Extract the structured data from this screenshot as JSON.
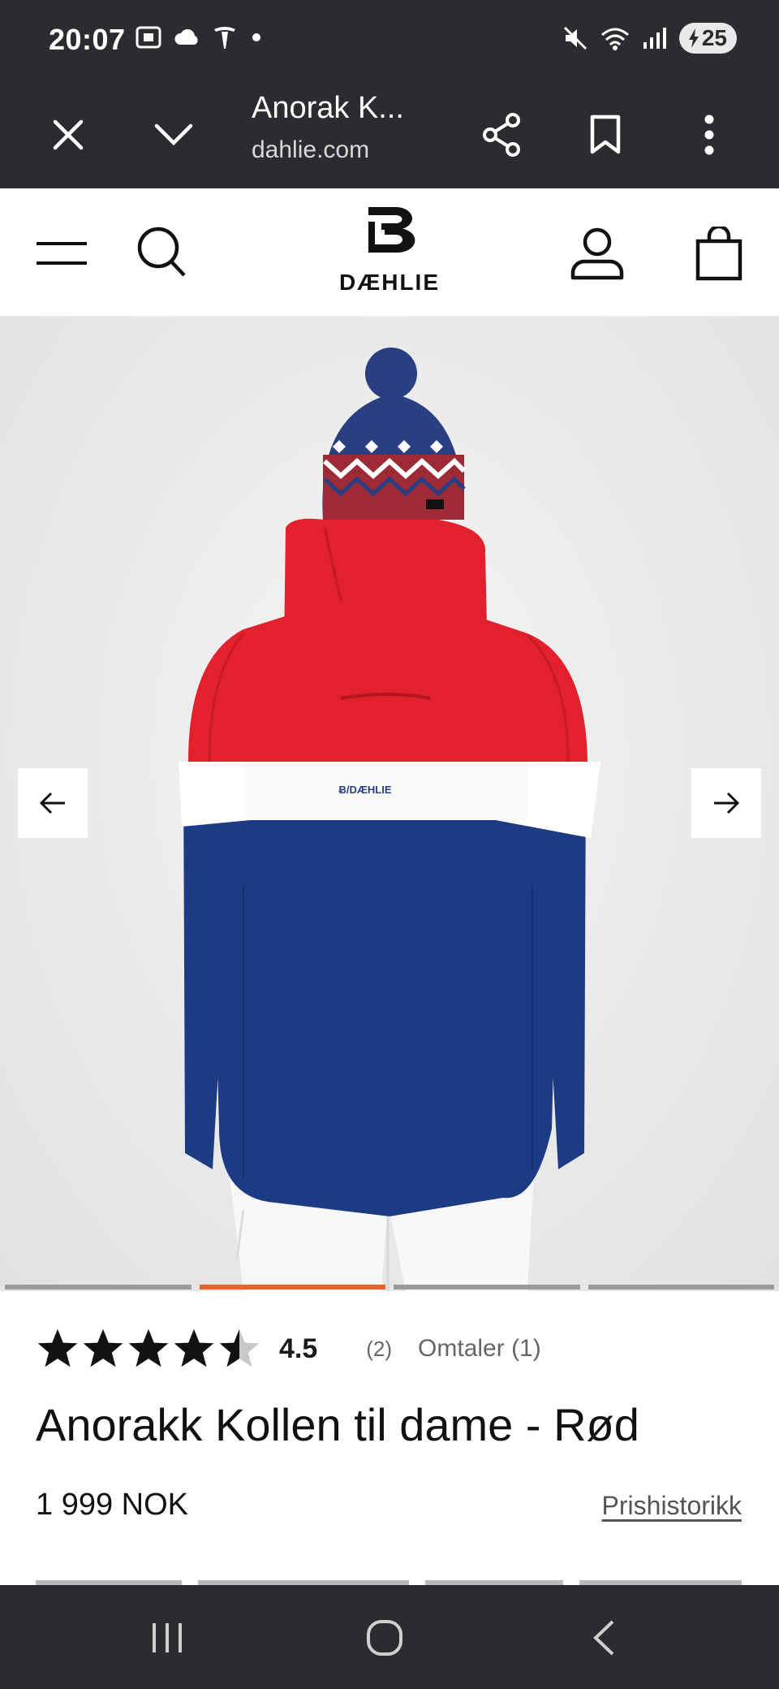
{
  "status": {
    "time": "20:07",
    "battery": "25"
  },
  "browser": {
    "title": "Anorak K...",
    "domain": "dahlie.com"
  },
  "header": {
    "brand": "DÆHLIE"
  },
  "product": {
    "rating": 4.5,
    "rating_label": "4.5",
    "rating_count": "(2)",
    "reviews_link": "Omtaler (1)",
    "title": "Anorakk Kollen til dame - Rød",
    "price": "1 999 NOK",
    "price_history": "Prishistorikk"
  },
  "gallery": {
    "image_count": 4,
    "active_index": 2,
    "jacket_logo": "Ƀ/DÆHLIE"
  },
  "colors": {
    "chrome": "#2b2c2f",
    "accent": "#e8622a",
    "jacket_red": "#e3212d",
    "jacket_blue": "#1d3b84"
  },
  "icons": {
    "close": "close-icon",
    "expand": "chevron-down-icon",
    "share": "share-icon",
    "bookmark": "bookmark-icon",
    "more": "more-vert-icon",
    "menu": "menu-icon",
    "search": "search-icon",
    "account": "user-icon",
    "cart": "bag-icon",
    "prev": "arrow-left-icon",
    "next": "arrow-right-icon"
  }
}
